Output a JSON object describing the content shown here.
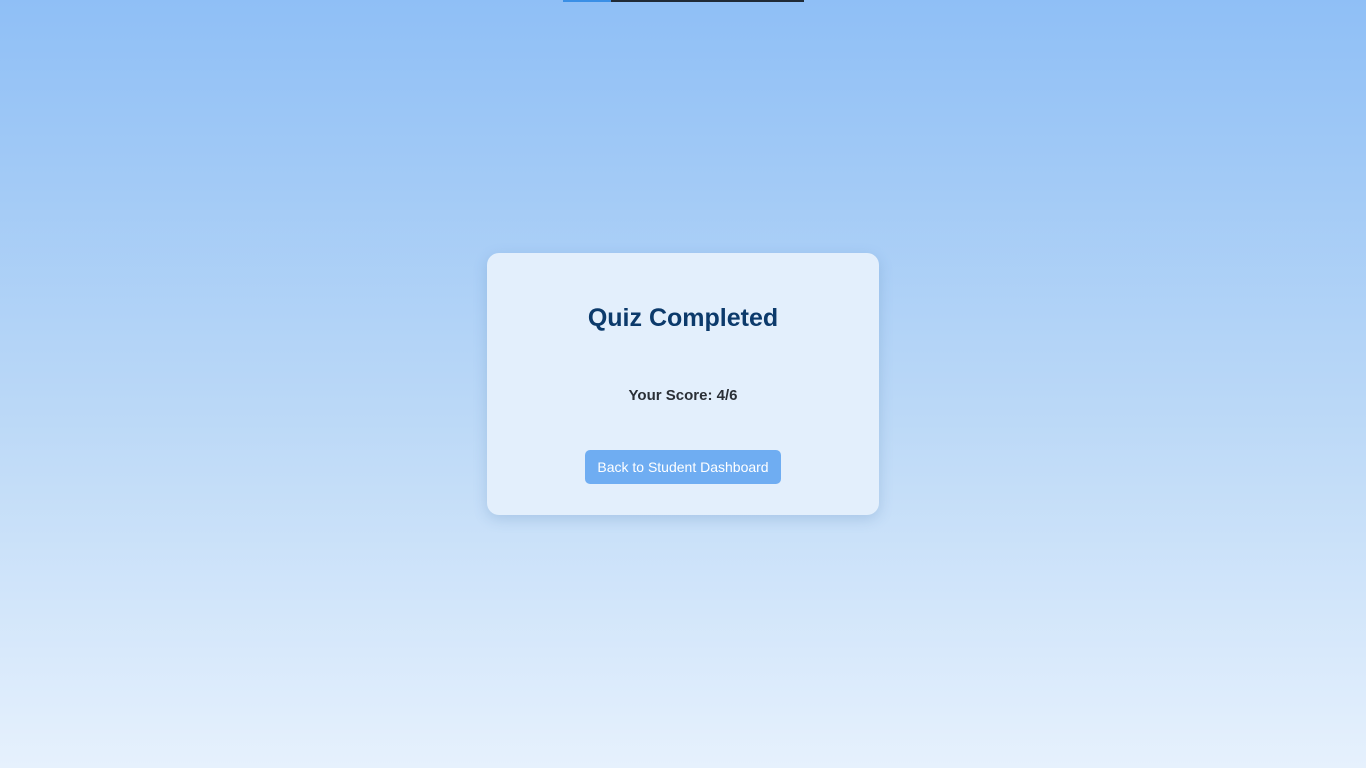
{
  "progress": {
    "fraction": 0.2
  },
  "result": {
    "title": "Quiz Completed",
    "score_text": "Your Score: 4/6",
    "back_button_label": "Back to Student Dashboard"
  },
  "colors": {
    "background_top": "#8fbff6",
    "background_bottom": "#e6f1fd",
    "card_background": "#e3effc",
    "title": "#0c3a6b",
    "button": "#6fadf2",
    "progress_fill": "#3a8fe6",
    "progress_track": "#1f2a36"
  }
}
